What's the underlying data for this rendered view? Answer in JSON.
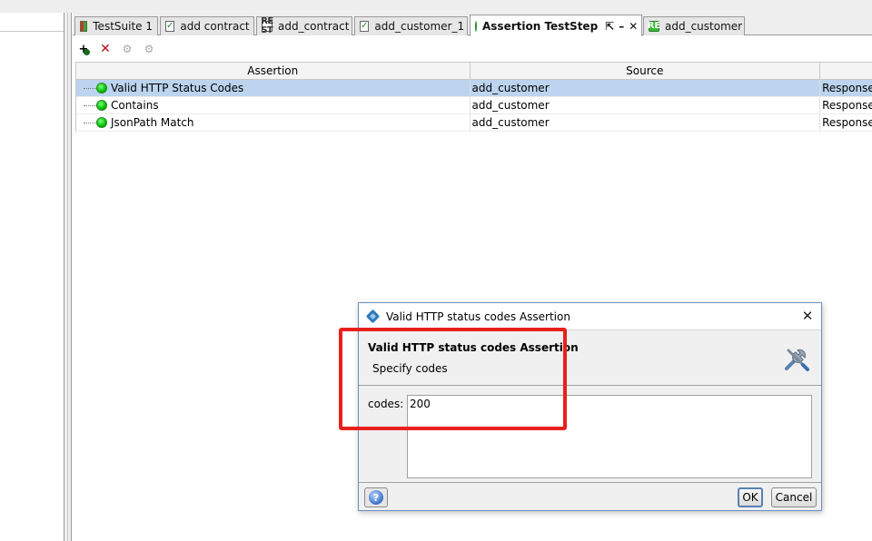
{
  "tabs": [
    {
      "label": "TestSuite 1",
      "icon": "testsuite-icon"
    },
    {
      "label": "add contract",
      "icon": "testcase-icon"
    },
    {
      "label": "add_contract",
      "icon": "rest-icon"
    },
    {
      "label": "add_customer_1",
      "icon": "testcase-icon"
    },
    {
      "label": "Assertion TestStep",
      "icon": "status-green-icon",
      "active": true
    },
    {
      "label": "add_customer",
      "icon": "rest-green-icon"
    }
  ],
  "toolbar": {
    "add": "add-assertion-icon",
    "remove": "remove-assertion-icon",
    "configure": "configure-icon",
    "disabled": "disabled-icon"
  },
  "table": {
    "columns": [
      "Assertion",
      "Source",
      ""
    ],
    "rows": [
      {
        "assertion": "Valid HTTP Status Codes",
        "source": "add_customer",
        "property": "Response",
        "status": "valid"
      },
      {
        "assertion": "Contains",
        "source": "add_customer",
        "property": "Response",
        "status": "valid"
      },
      {
        "assertion": "JsonPath Match",
        "source": "add_customer",
        "property": "Response",
        "status": "valid"
      }
    ],
    "status_color": "#00c000"
  },
  "dialog": {
    "title": "Valid HTTP status codes Assertion",
    "heading": "Valid HTTP status codes Assertion",
    "subheading": "Specify codes",
    "codes_label": "codes:",
    "codes_value": "200",
    "ok_label": "OK",
    "cancel_label": "Cancel"
  },
  "colors": {
    "highlight": "#e8201c",
    "selected_row": "#bcd4ee"
  }
}
